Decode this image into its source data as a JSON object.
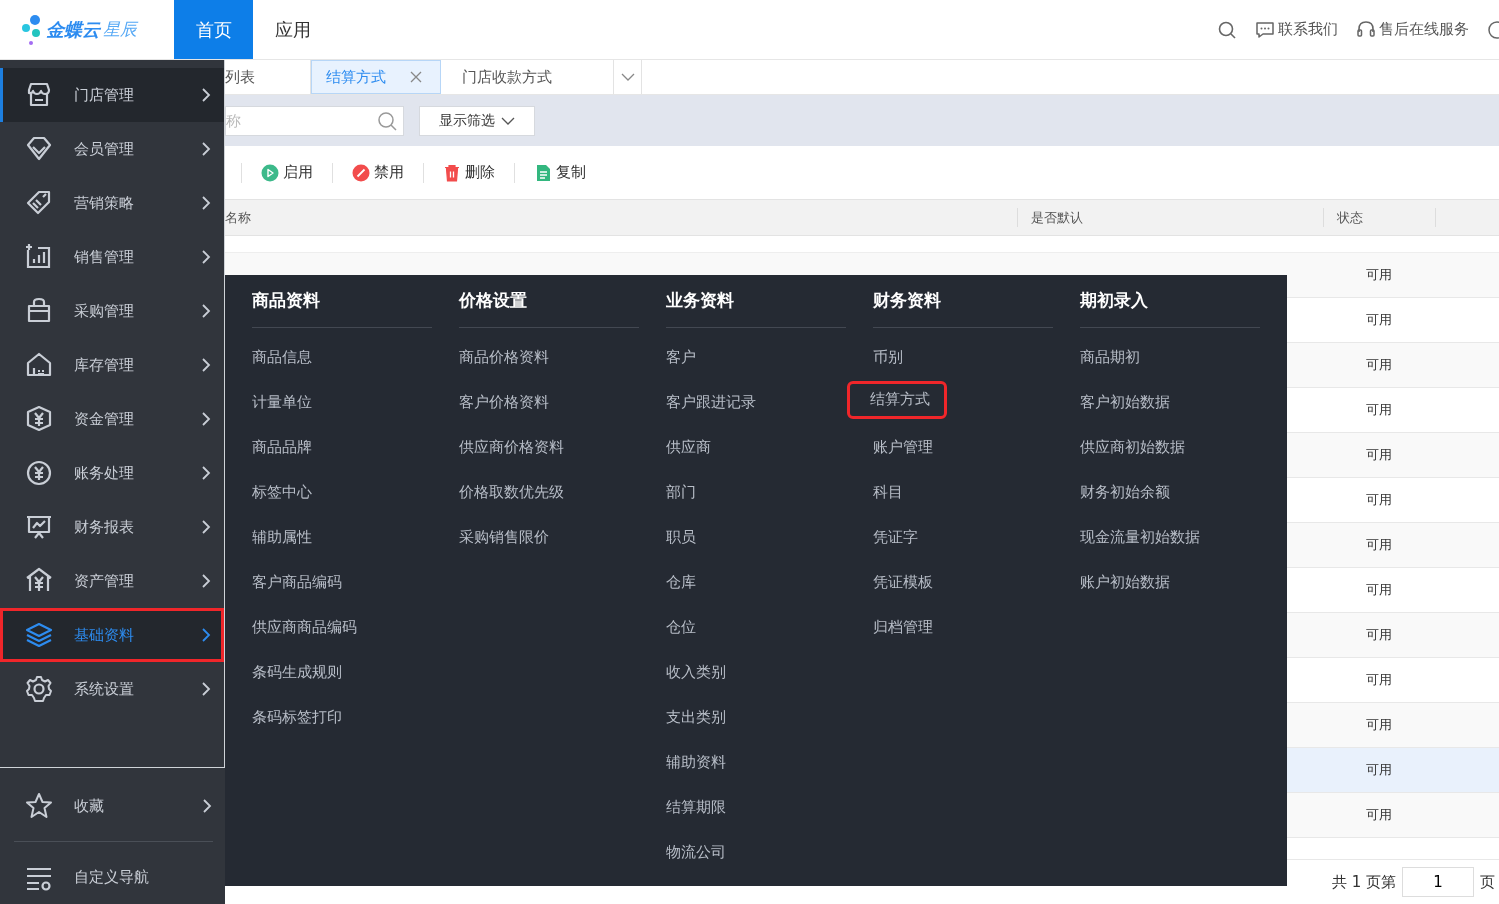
{
  "header": {
    "logo": {
      "brand": "金蝶云",
      "product": "星辰"
    },
    "nav": [
      {
        "label": "首页",
        "selected": true
      },
      {
        "label": "应用",
        "selected": false
      }
    ],
    "links": [
      {
        "label": "联系我们"
      },
      {
        "label": "售后在线服务"
      }
    ]
  },
  "sidebar": {
    "items": [
      {
        "label": "门店管理",
        "current": true,
        "selected": false,
        "highlighted": false
      },
      {
        "label": "会员管理",
        "current": false,
        "selected": false,
        "highlighted": false
      },
      {
        "label": "营销策略",
        "current": false,
        "selected": false,
        "highlighted": false
      },
      {
        "label": "销售管理",
        "current": false,
        "selected": false,
        "highlighted": false
      },
      {
        "label": "采购管理",
        "current": false,
        "selected": false,
        "highlighted": false
      },
      {
        "label": "库存管理",
        "current": false,
        "selected": false,
        "highlighted": false
      },
      {
        "label": "资金管理",
        "current": false,
        "selected": false,
        "highlighted": false
      },
      {
        "label": "账务处理",
        "current": false,
        "selected": false,
        "highlighted": false
      },
      {
        "label": "财务报表",
        "current": false,
        "selected": false,
        "highlighted": false
      },
      {
        "label": "资产管理",
        "current": false,
        "selected": false,
        "highlighted": false
      },
      {
        "label": "基础资料",
        "current": false,
        "selected": true,
        "highlighted": true
      },
      {
        "label": "系统设置",
        "current": false,
        "selected": false,
        "highlighted": false
      }
    ],
    "favorites": {
      "label": "收藏"
    },
    "custom_nav": {
      "label": "自定义导航"
    }
  },
  "tabs": [
    {
      "label": "列表",
      "selected": false,
      "closable": false
    },
    {
      "label": "结算方式",
      "selected": true,
      "closable": true
    },
    {
      "label": "门店收款方式",
      "selected": false,
      "closable": false
    }
  ],
  "filter": {
    "search": {
      "placeholder": "称"
    },
    "button": "显示筛选"
  },
  "toolbar": [
    {
      "label": "启用",
      "kind": "enable"
    },
    {
      "label": "禁用",
      "kind": "disable"
    },
    {
      "label": "删除",
      "kind": "delete"
    },
    {
      "label": "复制",
      "kind": "copy"
    }
  ],
  "table": {
    "columns": [
      "名称",
      "是否默认",
      "状态"
    ],
    "rows": [
      {
        "status": "可用",
        "selected": false
      },
      {
        "status": "可用",
        "selected": false
      },
      {
        "status": "可用",
        "selected": false
      },
      {
        "status": "可用",
        "selected": false
      },
      {
        "status": "可用",
        "selected": false
      },
      {
        "status": "可用",
        "selected": false
      },
      {
        "status": "可用",
        "selected": false
      },
      {
        "status": "可用",
        "selected": false
      },
      {
        "status": "可用",
        "selected": false
      },
      {
        "status": "可用",
        "selected": false
      },
      {
        "status": "可用",
        "selected": false
      },
      {
        "status": "可用",
        "selected": true
      },
      {
        "status": "可用",
        "selected": false
      }
    ]
  },
  "pagination": {
    "prefix": "共 1 页第",
    "page": "1",
    "suffix": "页"
  },
  "mega_menu": {
    "columns": [
      {
        "title": "商品资料",
        "items": [
          {
            "label": "商品信息",
            "highlighted": false
          },
          {
            "label": "计量单位",
            "highlighted": false
          },
          {
            "label": "商品品牌",
            "highlighted": false
          },
          {
            "label": "标签中心",
            "highlighted": false
          },
          {
            "label": "辅助属性",
            "highlighted": false
          },
          {
            "label": "客户商品编码",
            "highlighted": false
          },
          {
            "label": "供应商商品编码",
            "highlighted": false
          },
          {
            "label": "条码生成规则",
            "highlighted": false
          },
          {
            "label": "条码标签打印",
            "highlighted": false
          }
        ]
      },
      {
        "title": "价格设置",
        "items": [
          {
            "label": "商品价格资料",
            "highlighted": false
          },
          {
            "label": "客户价格资料",
            "highlighted": false
          },
          {
            "label": "供应商价格资料",
            "highlighted": false
          },
          {
            "label": "价格取数优先级",
            "highlighted": false
          },
          {
            "label": "采购销售限价",
            "highlighted": false
          }
        ]
      },
      {
        "title": "业务资料",
        "items": [
          {
            "label": "客户",
            "highlighted": false
          },
          {
            "label": "客户跟进记录",
            "highlighted": false
          },
          {
            "label": "供应商",
            "highlighted": false
          },
          {
            "label": "部门",
            "highlighted": false
          },
          {
            "label": "职员",
            "highlighted": false
          },
          {
            "label": "仓库",
            "highlighted": false
          },
          {
            "label": "仓位",
            "highlighted": false
          },
          {
            "label": "收入类别",
            "highlighted": false
          },
          {
            "label": "支出类别",
            "highlighted": false
          },
          {
            "label": "辅助资料",
            "highlighted": false
          },
          {
            "label": "结算期限",
            "highlighted": false
          },
          {
            "label": "物流公司",
            "highlighted": false
          }
        ]
      },
      {
        "title": "财务资料",
        "items": [
          {
            "label": "币别",
            "highlighted": false
          },
          {
            "label": "结算方式",
            "highlighted": true
          },
          {
            "label": "账户管理",
            "highlighted": false
          },
          {
            "label": "科目",
            "highlighted": false
          },
          {
            "label": "凭证字",
            "highlighted": false
          },
          {
            "label": "凭证模板",
            "highlighted": false
          },
          {
            "label": "归档管理",
            "highlighted": false
          }
        ]
      },
      {
        "title": "期初录入",
        "items": [
          {
            "label": "商品期初",
            "highlighted": false
          },
          {
            "label": "客户初始数据",
            "highlighted": false
          },
          {
            "label": "供应商初始数据",
            "highlighted": false
          },
          {
            "label": "财务初始余额",
            "highlighted": false
          },
          {
            "label": "现金流量初始数据",
            "highlighted": false
          },
          {
            "label": "账户初始数据",
            "highlighted": false
          }
        ]
      }
    ]
  }
}
